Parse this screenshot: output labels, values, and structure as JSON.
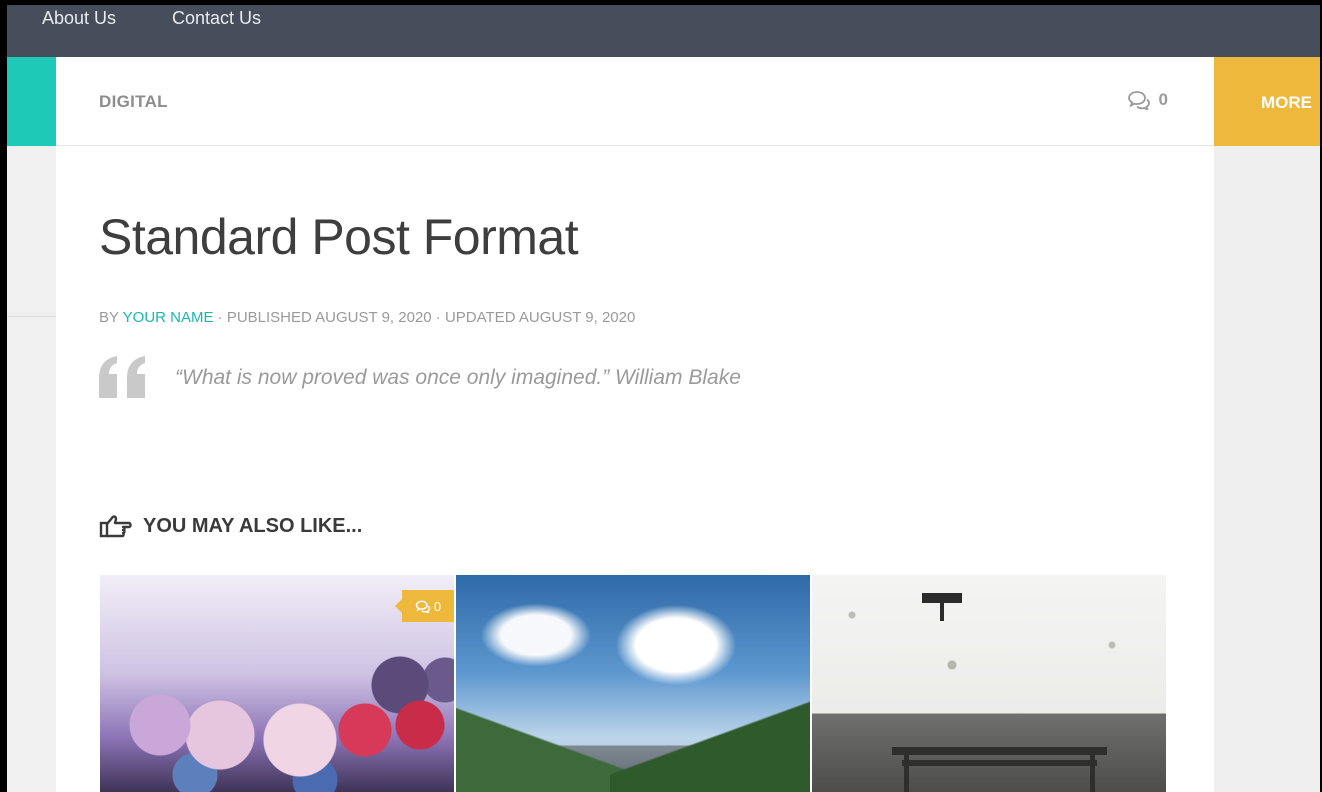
{
  "topnav": {
    "items": [
      {
        "label": "About Us"
      },
      {
        "label": "Contact Us"
      }
    ]
  },
  "category_bar": {
    "category": "DIGITAL",
    "comment_count": "0",
    "more_label": "MORE"
  },
  "post": {
    "title": "Standard Post Format",
    "byline": {
      "by": "BY ",
      "author": "YOUR NAME",
      "published": " · PUBLISHED AUGUST 9, 2020 · UPDATED AUGUST 9, 2020"
    },
    "quote": "“What is now proved was once only imagined.” William Blake"
  },
  "related": {
    "heading": "YOU MAY ALSO LIKE...",
    "items": [
      {
        "image": "frozen-berries",
        "comment_count": "0"
      },
      {
        "image": "mountain-road"
      },
      {
        "image": "bench-wall"
      }
    ]
  },
  "colors": {
    "accent_teal": "#1fc9b8",
    "accent_yellow": "#eeb83d",
    "nav_bg": "#464e5b"
  },
  "icons": [
    "comments-icon",
    "quote-icon",
    "hand-point-right-icon"
  ]
}
